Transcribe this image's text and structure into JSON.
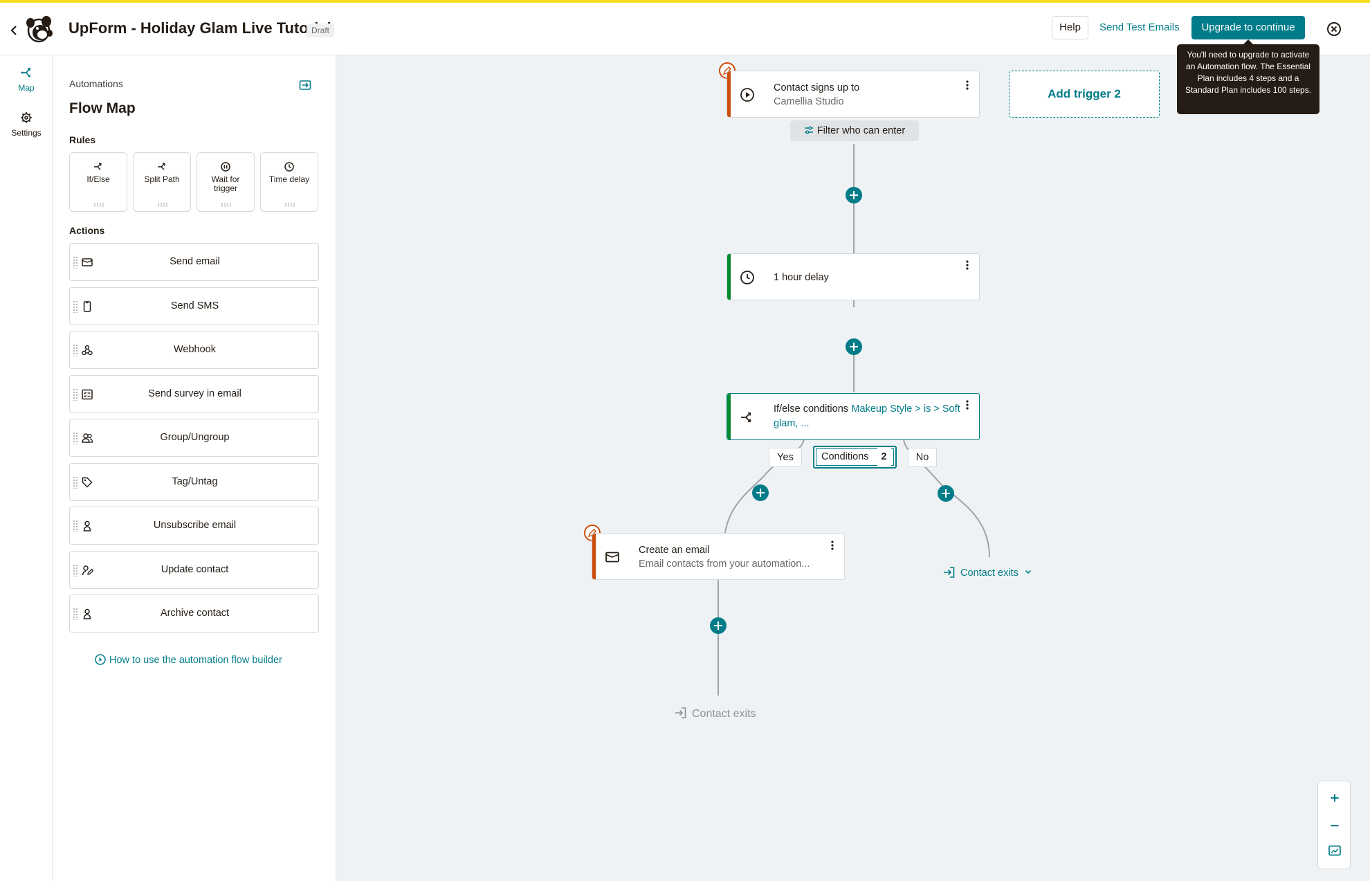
{
  "header": {
    "title": "UpForm - Holiday Glam Live Tutorial",
    "status_badge": "Draft",
    "help_label": "Help",
    "send_test_label": "Send Test Emails",
    "upgrade_label": "Upgrade to continue",
    "upgrade_tooltip": "You'll need to upgrade to activate an Automation flow. The Essential Plan includes 4 steps and a Standard Plan includes 100 steps."
  },
  "nav": {
    "items": [
      {
        "label": "Map",
        "icon": "flow-map-icon",
        "active": true
      },
      {
        "label": "Settings",
        "icon": "gear-icon",
        "active": false
      }
    ]
  },
  "panel": {
    "breadcrumb": "Automations",
    "title": "Flow Map",
    "rules_heading": "Rules",
    "rules": [
      {
        "label": "If/Else",
        "icon": "if-else-icon"
      },
      {
        "label": "Split Path",
        "icon": "split-path-icon"
      },
      {
        "label": "Wait for trigger",
        "icon": "wait-trigger-icon"
      },
      {
        "label": "Time delay",
        "icon": "clock-icon"
      }
    ],
    "actions_heading": "Actions",
    "actions": [
      {
        "label": "Send email",
        "icon": "email-icon"
      },
      {
        "label": "Send SMS",
        "icon": "phone-icon"
      },
      {
        "label": "Webhook",
        "icon": "webhook-icon"
      },
      {
        "label": "Send survey in email",
        "icon": "survey-icon"
      },
      {
        "label": "Group/Ungroup",
        "icon": "group-icon"
      },
      {
        "label": "Tag/Untag",
        "icon": "tag-icon"
      },
      {
        "label": "Unsubscribe email",
        "icon": "person-icon"
      },
      {
        "label": "Update contact",
        "icon": "edit-contact-icon"
      },
      {
        "label": "Archive contact",
        "icon": "person-icon"
      }
    ],
    "help_link": "How to use the automation flow builder"
  },
  "flow": {
    "trigger": {
      "line1": "Contact signs up to",
      "line2": "Camellia Studio"
    },
    "filter_label": "Filter who can enter",
    "add_trigger_label": "Add trigger 2",
    "delay_label": "1 hour delay",
    "ifelse": {
      "prefix": "If/else conditions",
      "condition": "Makeup Style > is > Soft glam, ..."
    },
    "yes_label": "Yes",
    "no_label": "No",
    "conditions_label": "Conditions",
    "conditions_count": "2",
    "email": {
      "title": "Create an email",
      "subtitle": "Email contacts from your automation..."
    },
    "exit_label": "Contact exits",
    "exit_branch_label": "Contact exits"
  },
  "colors": {
    "accent": "#007c89",
    "warning_orange": "#cc4c0a",
    "success_green": "#00892e",
    "top_stripe": "#f5dd1f"
  }
}
